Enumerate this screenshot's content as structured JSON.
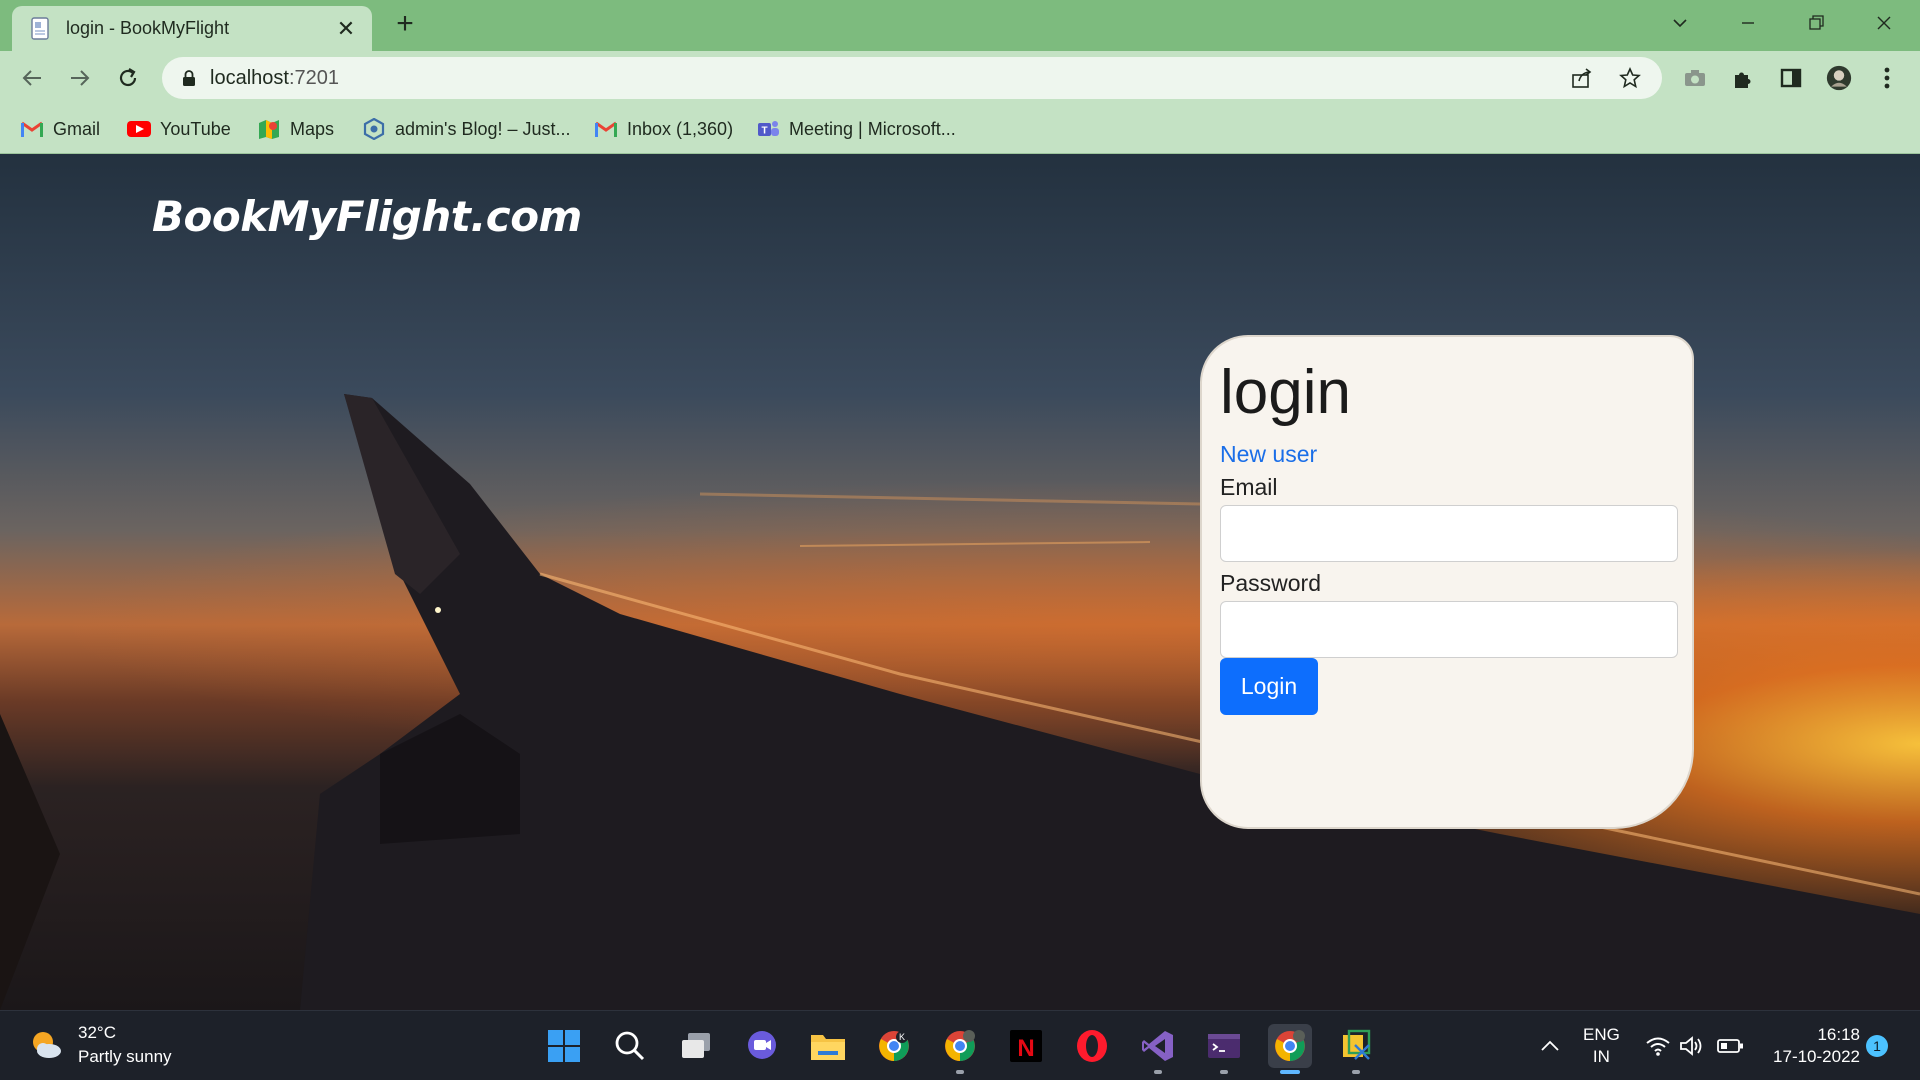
{
  "browser": {
    "tab_title": "login - BookMyFlight",
    "address_host": "localhost",
    "address_port": ":7201",
    "bookmarks": [
      {
        "label": "Gmail",
        "icon": "gmail-icon"
      },
      {
        "label": "YouTube",
        "icon": "youtube-icon"
      },
      {
        "label": "Maps",
        "icon": "maps-icon"
      },
      {
        "label": "admin's Blog! – Just...",
        "icon": "blog-icon"
      },
      {
        "label": "Inbox (1,360)",
        "icon": "gmail-icon"
      },
      {
        "label": "Meeting | Microsoft...",
        "icon": "teams-icon"
      }
    ]
  },
  "page": {
    "site_title": "BookMyFlight.com",
    "login": {
      "heading": "login",
      "new_user_link": "New user",
      "email_label": "Email",
      "email_value": "",
      "password_label": "Password",
      "password_value": "",
      "submit_label": "Login"
    }
  },
  "taskbar": {
    "weather_temp": "32°C",
    "weather_desc": "Partly sunny",
    "lang_line1": "ENG",
    "lang_line2": "IN",
    "time": "16:18",
    "date": "17-10-2022",
    "notification_count": "1"
  },
  "colors": {
    "chrome_bg": "#7dbb7e",
    "chrome_toolbar": "#c4e2c4",
    "primary_button": "#0d6efd",
    "link": "#1a6ee8",
    "card_bg": "#f8f4ee"
  }
}
